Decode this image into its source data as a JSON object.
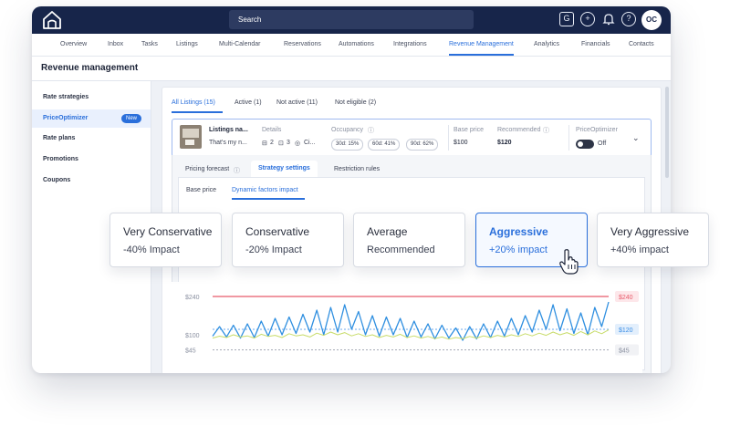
{
  "topbar": {
    "search_placeholder": "Search",
    "icons": [
      "home-logo-icon",
      "guidebook-icon",
      "plus-circle-icon",
      "bell-icon",
      "help-icon"
    ],
    "avatar_initials": "OC"
  },
  "nav": {
    "items": [
      "Overview",
      "Inbox",
      "Tasks",
      "Listings",
      "Multi-Calendar",
      "Reservations",
      "Automations",
      "Integrations",
      "Revenue Management",
      "Analytics",
      "Financials",
      "Contacts"
    ],
    "active": "Revenue Management"
  },
  "page": {
    "title": "Revenue management"
  },
  "sidebar": {
    "items": [
      {
        "label": "Rate strategies"
      },
      {
        "label": "PriceOptimizer",
        "badge": "New"
      },
      {
        "label": "Rate plans"
      },
      {
        "label": "Promotions"
      },
      {
        "label": "Coupons"
      }
    ]
  },
  "filters": {
    "tabs": [
      "All Listings (15)",
      "Active (1)",
      "Not active (11)",
      "Not eligible (2)"
    ]
  },
  "listing": {
    "name": "Listings na...",
    "description": "That's my n...",
    "details_label": "Details",
    "beds": "2",
    "baths": "3",
    "location": "Ci...",
    "occupancy_label": "Occupancy",
    "occupancy": [
      "30d: 15%",
      "60d: 41%",
      "90d: 62%"
    ],
    "base_price_label": "Base price",
    "base_price": "$100",
    "recommended_label": "Recommended",
    "recommended": "$120",
    "optimizer_label": "PriceOptimizer",
    "optimizer_state": "Off"
  },
  "panel": {
    "tabs": [
      "Pricing forecast",
      "Strategy settings",
      "Restriction rules"
    ],
    "subtabs": [
      "Base price",
      "Dynamic factors impact"
    ]
  },
  "strategies": [
    {
      "title": "Very Conservative",
      "sub": "-40% Impact"
    },
    {
      "title": "Conservative",
      "sub": "-20% Impact"
    },
    {
      "title": "Average",
      "sub": "Recommended"
    },
    {
      "title": "Aggressive",
      "sub": "+20% impact"
    },
    {
      "title": "Very Aggressive",
      "sub": "+40% impact"
    }
  ],
  "chart_data": {
    "type": "line",
    "y_tick_labels": [
      "$240",
      "$100",
      "$45"
    ],
    "reference_lines": [
      {
        "label": "$240",
        "value": 240,
        "color": "#e85b6b"
      },
      {
        "label": "$120",
        "value": 120,
        "color": "#3b8ee6"
      },
      {
        "label": "$45",
        "value": 45,
        "color": "#8a90a0"
      }
    ],
    "series": [
      {
        "color": "#2f8fe0",
        "values": [
          95,
          130,
          92,
          135,
          88,
          140,
          90,
          150,
          95,
          160,
          100,
          165,
          105,
          175,
          110,
          190,
          100,
          200,
          110,
          210,
          120,
          185,
          100,
          170,
          95,
          165,
          100,
          160,
          90,
          150,
          92,
          140,
          85,
          135,
          88,
          125,
          80,
          130,
          85,
          140,
          90,
          150,
          95,
          160,
          100,
          170,
          110,
          190,
          120,
          210,
          115,
          195,
          105,
          180,
          100,
          200,
          130,
          220
        ]
      },
      {
        "color": "#c8dc6a",
        "values": [
          88,
          95,
          90,
          100,
          92,
          96,
          88,
          102,
          94,
          98,
          90,
          104,
          96,
          100,
          92,
          106,
          98,
          110,
          100,
          108,
          96,
          104,
          94,
          100,
          90,
          98,
          92,
          102,
          90,
          96,
          88,
          94,
          86,
          92,
          84,
          90,
          86,
          94,
          88,
          96,
          90,
          98,
          92,
          100,
          94,
          104,
          96,
          106,
          98,
          110,
          100,
          108,
          98,
          112,
          100,
          114,
          104,
          118
        ]
      }
    ]
  },
  "colors": {
    "brand": "#17254a",
    "accent": "#2a6fdb"
  }
}
